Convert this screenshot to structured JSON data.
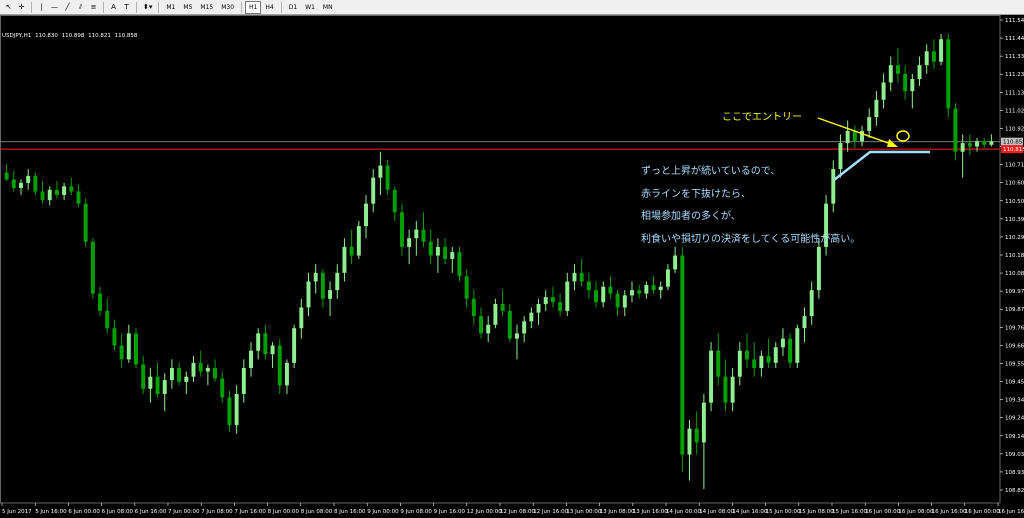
{
  "toolbar": {
    "tools": [
      {
        "name": "cursor-icon",
        "glyph": "↖"
      },
      {
        "name": "crosshair-icon",
        "glyph": "✛"
      },
      {
        "name": "vertical-line-icon",
        "glyph": "|"
      },
      {
        "name": "horizontal-line-icon",
        "glyph": "—"
      },
      {
        "name": "trendline-icon",
        "glyph": "╱"
      },
      {
        "name": "channel-icon",
        "glyph": "⫽"
      },
      {
        "name": "fibonacci-icon",
        "glyph": "≡"
      },
      {
        "name": "text-icon",
        "glyph": "A"
      },
      {
        "name": "text-label-icon",
        "glyph": "T"
      },
      {
        "name": "arrows-icon",
        "glyph": "⬍▾"
      }
    ],
    "timeframes": [
      "M1",
      "M5",
      "M15",
      "M30",
      "H1",
      "H4",
      "D1",
      "W1",
      "MN"
    ],
    "active_timeframe": "H1"
  },
  "symbol_info": {
    "symbol": "USDJPY,H1",
    "open": "110.830",
    "high": "110.898",
    "low": "110.821",
    "close": "110.858"
  },
  "price_axis": {
    "labels": [
      "111.545",
      "111.440",
      "111.335",
      "111.235",
      "111.130",
      "111.025",
      "110.920",
      "110.815",
      "110.710",
      "110.605",
      "110.500",
      "110.395",
      "110.290",
      "110.185",
      "110.080",
      "109.975",
      "109.870",
      "109.765",
      "109.660",
      "109.555",
      "109.450",
      "109.345",
      "109.240",
      "109.140",
      "109.035",
      "108.930",
      "108.825"
    ],
    "current_price": "110.858",
    "red_line_price": "110.815"
  },
  "time_axis": {
    "labels": [
      "5 Jun 2017",
      "5 Jun 16:00",
      "6 Jun 00:00",
      "6 Jun 08:00",
      "6 Jun 16:00",
      "7 Jun 00:00",
      "7 Jun 08:00",
      "7 Jun 16:00",
      "8 Jun 00:00",
      "8 Jun 08:00",
      "8 Jun 16:00",
      "9 Jun 00:00",
      "9 Jun 08:00",
      "9 Jun 16:00",
      "12 Jun 00:00",
      "12 Jun 08:00",
      "12 Jun 16:00",
      "13 Jun 00:00",
      "13 Jun 08:00",
      "13 Jun 16:00",
      "14 Jun 00:00",
      "14 Jun 08:00",
      "14 Jun 16:00",
      "15 Jun 00:00",
      "15 Jun 08:00",
      "15 Jun 16:00",
      "16 Jun 00:00",
      "16 Jun 08:00",
      "16 Jun 16:00",
      "16 Jun 00:00",
      "16 Jun 16:00"
    ]
  },
  "annotation": {
    "entry_label": "ここでエントリー",
    "notes": [
      "ずっと上昇が続いているので、",
      "赤ラインを下抜けたら、",
      "相場参加者の多くが、",
      "利食いや損切りの決済をしてくる可能性が高い。"
    ]
  },
  "colors": {
    "background": "#000000",
    "bull_candle": "#90ee90",
    "bear_candle": "#00a000",
    "red_line": "#ff1a1a",
    "grey_line": "#8a8a8a",
    "entry_label": "#ffff00",
    "note_text": "#a6dcff",
    "support_line": "#a6dcff"
  },
  "chart_data": {
    "type": "candlestick",
    "series": "USDJPY",
    "y_unit": "JPY",
    "ylim": [
      108.77,
      111.59
    ],
    "candles": [
      [
        110.68,
        110.73,
        110.63,
        110.64
      ],
      [
        110.64,
        110.69,
        110.57,
        110.59
      ],
      [
        110.59,
        110.64,
        110.55,
        110.62
      ],
      [
        110.62,
        110.7,
        110.58,
        110.66
      ],
      [
        110.66,
        110.68,
        110.55,
        110.57
      ],
      [
        110.57,
        110.63,
        110.5,
        110.52
      ],
      [
        110.52,
        110.6,
        110.49,
        110.58
      ],
      [
        110.58,
        110.63,
        110.53,
        110.55
      ],
      [
        110.55,
        110.62,
        110.52,
        110.6
      ],
      [
        110.6,
        110.65,
        110.55,
        110.57
      ],
      [
        110.57,
        110.61,
        110.48,
        110.5
      ],
      [
        110.5,
        110.53,
        110.25,
        110.28
      ],
      [
        110.28,
        110.3,
        109.95,
        109.98
      ],
      [
        109.98,
        110.02,
        109.85,
        109.88
      ],
      [
        109.88,
        109.95,
        109.75,
        109.78
      ],
      [
        109.78,
        109.83,
        109.65,
        109.68
      ],
      [
        109.68,
        109.75,
        109.55,
        109.6
      ],
      [
        109.6,
        109.8,
        109.58,
        109.75
      ],
      [
        109.75,
        109.78,
        109.55,
        109.57
      ],
      [
        109.57,
        109.62,
        109.4,
        109.43
      ],
      [
        109.43,
        109.55,
        109.35,
        109.5
      ],
      [
        109.5,
        109.58,
        109.38,
        109.4
      ],
      [
        109.4,
        109.52,
        109.3,
        109.48
      ],
      [
        109.48,
        109.6,
        109.43,
        109.55
      ],
      [
        109.55,
        109.58,
        109.45,
        109.47
      ],
      [
        109.47,
        109.53,
        109.4,
        109.5
      ],
      [
        109.5,
        109.62,
        109.47,
        109.58
      ],
      [
        109.58,
        109.65,
        109.5,
        109.53
      ],
      [
        109.53,
        109.57,
        109.45,
        109.55
      ],
      [
        109.55,
        109.6,
        109.47,
        109.49
      ],
      [
        109.49,
        109.53,
        109.35,
        109.38
      ],
      [
        109.38,
        109.42,
        109.18,
        109.22
      ],
      [
        109.22,
        109.45,
        109.17,
        109.4
      ],
      [
        109.4,
        109.6,
        109.35,
        109.55
      ],
      [
        109.55,
        109.7,
        109.5,
        109.65
      ],
      [
        109.65,
        109.78,
        109.6,
        109.75
      ],
      [
        109.75,
        109.8,
        109.6,
        109.63
      ],
      [
        109.63,
        109.7,
        109.55,
        109.68
      ],
      [
        109.68,
        109.72,
        109.4,
        109.45
      ],
      [
        109.45,
        109.6,
        109.4,
        109.58
      ],
      [
        109.58,
        109.8,
        109.55,
        109.78
      ],
      [
        109.78,
        109.95,
        109.72,
        109.9
      ],
      [
        109.9,
        110.1,
        109.85,
        110.05
      ],
      [
        110.05,
        110.15,
        109.98,
        110.1
      ],
      [
        110.1,
        110.12,
        109.9,
        109.95
      ],
      [
        109.95,
        110.05,
        109.85,
        110.0
      ],
      [
        110.0,
        110.15,
        109.95,
        110.1
      ],
      [
        110.1,
        110.3,
        110.05,
        110.25
      ],
      [
        110.25,
        110.35,
        110.15,
        110.2
      ],
      [
        110.2,
        110.4,
        110.18,
        110.37
      ],
      [
        110.37,
        110.55,
        110.3,
        110.5
      ],
      [
        110.5,
        110.7,
        110.45,
        110.65
      ],
      [
        110.65,
        110.8,
        110.55,
        110.72
      ],
      [
        110.72,
        110.75,
        110.55,
        110.58
      ],
      [
        110.58,
        110.6,
        110.4,
        110.45
      ],
      [
        110.45,
        110.5,
        110.2,
        110.25
      ],
      [
        110.25,
        110.35,
        110.15,
        110.3
      ],
      [
        110.3,
        110.4,
        110.2,
        110.35
      ],
      [
        110.35,
        110.45,
        110.25,
        110.28
      ],
      [
        110.28,
        110.35,
        110.15,
        110.2
      ],
      [
        110.2,
        110.3,
        110.1,
        110.25
      ],
      [
        110.25,
        110.3,
        110.15,
        110.18
      ],
      [
        110.18,
        110.25,
        110.1,
        110.22
      ],
      [
        110.22,
        110.25,
        110.05,
        110.08
      ],
      [
        110.08,
        110.12,
        109.9,
        109.95
      ],
      [
        109.95,
        110.0,
        109.8,
        109.85
      ],
      [
        109.85,
        109.9,
        109.72,
        109.75
      ],
      [
        109.75,
        109.85,
        109.7,
        109.8
      ],
      [
        109.8,
        109.95,
        109.78,
        109.92
      ],
      [
        109.92,
        110.0,
        109.85,
        109.88
      ],
      [
        109.88,
        109.92,
        109.7,
        109.72
      ],
      [
        109.72,
        109.8,
        109.6,
        109.75
      ],
      [
        109.75,
        109.85,
        109.7,
        109.82
      ],
      [
        109.82,
        109.9,
        109.78,
        109.87
      ],
      [
        109.87,
        109.95,
        109.8,
        109.92
      ],
      [
        109.92,
        110.0,
        109.88,
        109.96
      ],
      [
        109.96,
        110.02,
        109.9,
        109.93
      ],
      [
        109.93,
        109.98,
        109.85,
        109.88
      ],
      [
        109.88,
        110.1,
        109.85,
        110.05
      ],
      [
        110.05,
        110.15,
        110.0,
        110.1
      ],
      [
        110.1,
        110.18,
        110.02,
        110.05
      ],
      [
        110.05,
        110.1,
        109.95,
        110.0
      ],
      [
        110.0,
        110.05,
        109.9,
        109.93
      ],
      [
        109.93,
        110.05,
        109.9,
        110.02
      ],
      [
        110.02,
        110.08,
        109.95,
        109.98
      ],
      [
        109.98,
        110.0,
        109.85,
        109.9
      ],
      [
        109.9,
        110.0,
        109.85,
        109.97
      ],
      [
        109.97,
        110.05,
        109.93,
        110.0
      ],
      [
        110.0,
        110.03,
        109.95,
        109.98
      ],
      [
        109.98,
        110.05,
        109.95,
        110.03
      ],
      [
        110.03,
        110.08,
        109.98,
        110.0
      ],
      [
        110.0,
        110.05,
        109.95,
        110.02
      ],
      [
        110.02,
        110.15,
        110.0,
        110.12
      ],
      [
        110.12,
        110.25,
        110.1,
        110.2
      ],
      [
        110.2,
        110.25,
        108.95,
        109.05
      ],
      [
        109.05,
        109.25,
        108.9,
        109.2
      ],
      [
        109.2,
        109.3,
        109.05,
        109.12
      ],
      [
        109.12,
        109.4,
        108.85,
        109.35
      ],
      [
        109.35,
        109.7,
        109.3,
        109.65
      ],
      [
        109.65,
        109.75,
        109.45,
        109.5
      ],
      [
        109.5,
        109.6,
        109.3,
        109.35
      ],
      [
        109.35,
        109.55,
        109.3,
        109.5
      ],
      [
        109.5,
        109.7,
        109.45,
        109.65
      ],
      [
        109.65,
        109.75,
        109.55,
        109.6
      ],
      [
        109.6,
        109.7,
        109.5,
        109.55
      ],
      [
        109.55,
        109.65,
        109.5,
        109.62
      ],
      [
        109.62,
        109.72,
        109.55,
        109.58
      ],
      [
        109.58,
        109.7,
        109.55,
        109.67
      ],
      [
        109.67,
        109.78,
        109.62,
        109.72
      ],
      [
        109.72,
        109.75,
        109.55,
        109.58
      ],
      [
        109.58,
        109.8,
        109.55,
        109.78
      ],
      [
        109.78,
        109.9,
        109.7,
        109.85
      ],
      [
        109.85,
        110.05,
        109.8,
        110.0
      ],
      [
        110.0,
        110.3,
        109.95,
        110.25
      ],
      [
        110.25,
        110.55,
        110.2,
        110.5
      ],
      [
        110.5,
        110.75,
        110.45,
        110.7
      ],
      [
        110.7,
        110.9,
        110.65,
        110.85
      ],
      [
        110.85,
        110.98,
        110.8,
        110.92
      ],
      [
        110.92,
        110.95,
        110.82,
        110.86
      ],
      [
        110.86,
        110.95,
        110.83,
        110.92
      ],
      [
        110.92,
        111.05,
        110.88,
        111.0
      ],
      [
        111.0,
        111.15,
        110.95,
        111.1
      ],
      [
        111.1,
        111.25,
        111.05,
        111.2
      ],
      [
        111.2,
        111.35,
        111.15,
        111.3
      ],
      [
        111.3,
        111.4,
        111.2,
        111.25
      ],
      [
        111.25,
        111.3,
        111.1,
        111.15
      ],
      [
        111.15,
        111.25,
        111.05,
        111.22
      ],
      [
        111.22,
        111.35,
        111.18,
        111.3
      ],
      [
        111.3,
        111.42,
        111.25,
        111.38
      ],
      [
        111.38,
        111.45,
        111.28,
        111.32
      ],
      [
        111.32,
        111.48,
        111.3,
        111.45
      ],
      [
        111.45,
        111.48,
        111.0,
        111.05
      ],
      [
        111.05,
        111.08,
        110.75,
        110.8
      ],
      [
        110.8,
        110.9,
        110.65,
        110.85
      ],
      [
        110.85,
        110.9,
        110.78,
        110.83
      ],
      [
        110.83,
        110.88,
        110.8,
        110.86
      ],
      [
        110.86,
        110.88,
        110.82,
        110.84
      ],
      [
        110.84,
        110.9,
        110.83,
        110.86
      ]
    ]
  }
}
